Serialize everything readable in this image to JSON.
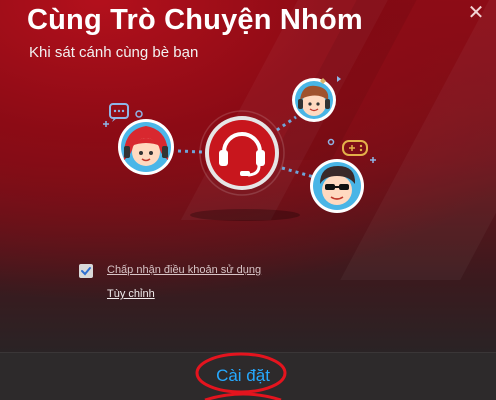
{
  "dialog": {
    "title": "Cùng Trò Chuyện Nhóm",
    "subtitle": "Khi sát cánh cùng bè bạn",
    "close_glyph": "✕"
  },
  "options": {
    "terms_checked": true,
    "terms_label": "Chấp nhận điều khoản sử dụng",
    "customize_label": "Tùy chỉnh"
  },
  "footer": {
    "install_label": "Cài đặt"
  },
  "icons": {
    "center": "headset-icon",
    "avatars": [
      "girl-avatar-icon",
      "boy-avatar-icon",
      "sunglasses-avatar-icon"
    ],
    "bubbles": [
      "chat-bubble-icon",
      "gamepad-bubble-icon"
    ]
  },
  "colors": {
    "brand_red": "#c8161d",
    "install_link": "#26a9ff",
    "annotation": "#e4141e"
  }
}
